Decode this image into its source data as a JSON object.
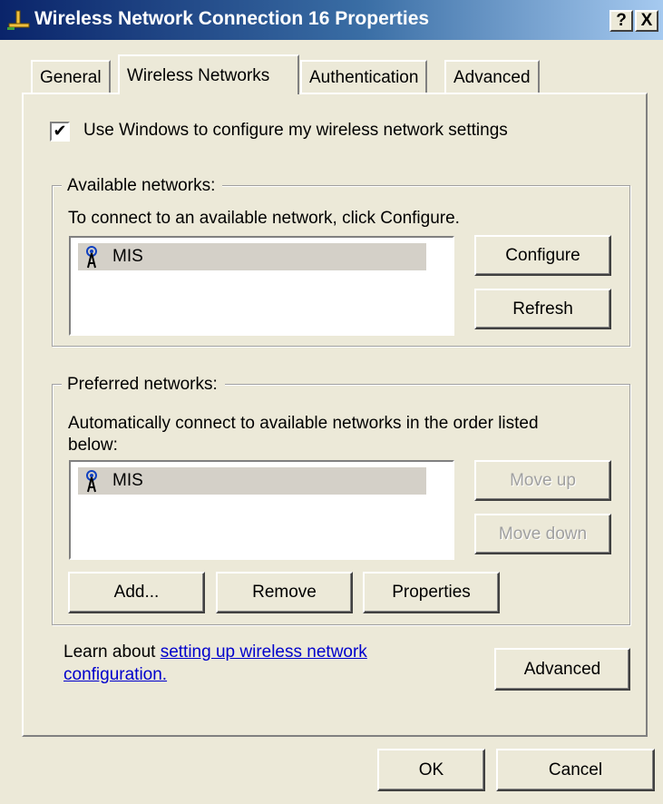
{
  "window": {
    "title": "Wireless Network Connection 16 Properties",
    "help_label": "?",
    "close_label": "X"
  },
  "tabs": [
    {
      "label": "General",
      "active": false
    },
    {
      "label": "Wireless Networks",
      "active": true
    },
    {
      "label": "Authentication",
      "active": false
    },
    {
      "label": "Advanced",
      "active": false
    }
  ],
  "config": {
    "use_windows_checked": true,
    "check_mark": "✔",
    "use_windows_label": "Use Windows to configure my wireless network settings"
  },
  "available": {
    "legend": "Available networks:",
    "description": "To connect to an available network, click Configure.",
    "networks": [
      {
        "name": "MIS",
        "icon": "wireless-antenna-icon"
      }
    ],
    "configure_label": "Configure",
    "refresh_label": "Refresh"
  },
  "preferred": {
    "legend": "Preferred networks:",
    "description_line1": "Automatically connect to available networks in the order listed",
    "description_line2": "below:",
    "networks": [
      {
        "name": "MIS",
        "icon": "wireless-antenna-icon"
      }
    ],
    "move_up_label": "Move up",
    "move_down_label": "Move down",
    "add_label": "Add...",
    "remove_label": "Remove",
    "properties_label": "Properties"
  },
  "learn": {
    "prefix": "Learn about ",
    "link_text": "setting up wireless network configuration."
  },
  "advanced_button_label": "Advanced",
  "footer": {
    "ok_label": "OK",
    "cancel_label": "Cancel"
  },
  "colors": {
    "dialog_bg": "#ece9d8",
    "titlebar_start": "#0a246a",
    "titlebar_end": "#a6caf0",
    "link": "#0000cc"
  }
}
